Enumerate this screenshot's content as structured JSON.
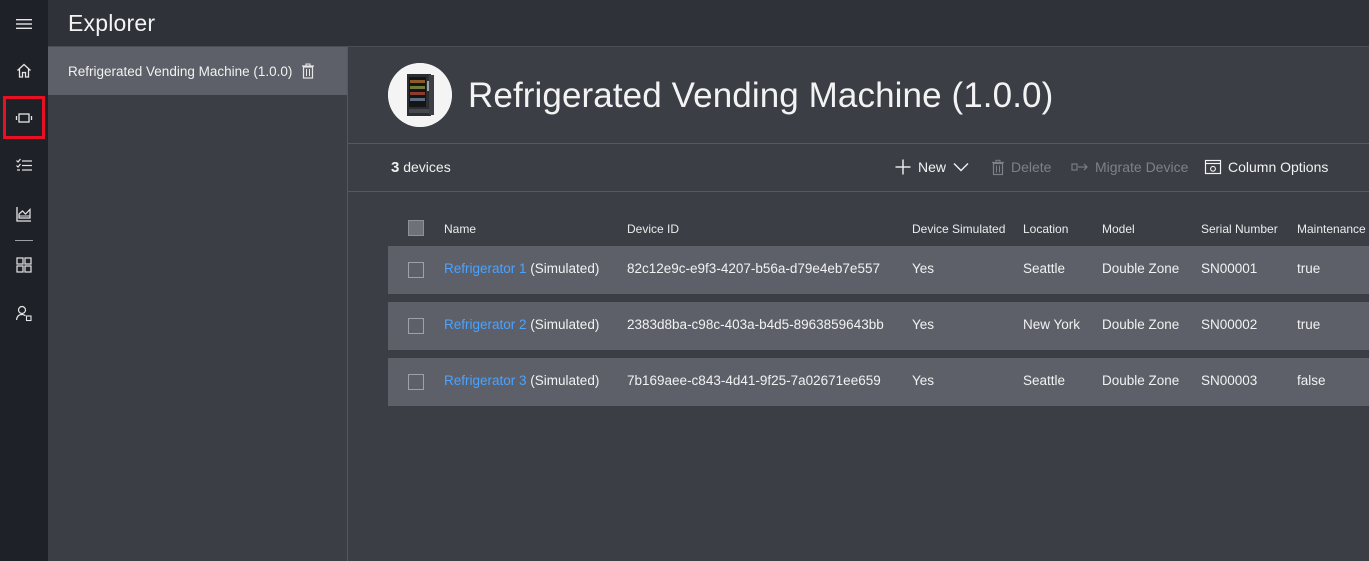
{
  "app": {
    "header_title": "Explorer"
  },
  "rail": {
    "items": [
      {
        "icon": "hamburger-menu-icon"
      },
      {
        "icon": "home-icon"
      },
      {
        "icon": "devices-icon",
        "active": true
      },
      {
        "icon": "rules-icon"
      },
      {
        "icon": "analytics-icon"
      },
      {
        "icon": "dashboard-icon"
      },
      {
        "icon": "administration-icon"
      }
    ],
    "highlight_color": "#e81123"
  },
  "templates": {
    "items": [
      {
        "label": "Refrigerated Vending Machine (1.0.0)",
        "selected": true
      }
    ]
  },
  "device_template": {
    "title": "Refrigerated Vending Machine (1.0.0)",
    "image_icon": "vending-machine-image"
  },
  "toolbar": {
    "count_number": "3",
    "count_label": "devices",
    "new_label": "New",
    "delete_label": "Delete",
    "migrate_label": "Migrate Device",
    "column_options_label": "Column Options"
  },
  "table": {
    "columns": [
      "Name",
      "Device ID",
      "Device Simulated",
      "Location",
      "Model",
      "Serial Number",
      "Maintenance"
    ],
    "rows": [
      {
        "name_link": "Refrigerator 1",
        "name_suffix": " (Simulated)",
        "device_id": "82c12e9c-e9f3-4207-b56a-d79e4eb7e557",
        "simulated": "Yes",
        "location": "Seattle",
        "model": "Double Zone",
        "serial": "SN00001",
        "maintenance": "true"
      },
      {
        "name_link": "Refrigerator 2",
        "name_suffix": " (Simulated)",
        "device_id": "2383d8ba-c98c-403a-b4d5-8963859643bb",
        "simulated": "Yes",
        "location": "New York",
        "model": "Double Zone",
        "serial": "SN00002",
        "maintenance": "true"
      },
      {
        "name_link": "Refrigerator 3",
        "name_suffix": " (Simulated)",
        "device_id": "7b169aee-c843-4d41-9f25-7a02671ee659",
        "simulated": "Yes",
        "location": "Seattle",
        "model": "Double Zone",
        "serial": "SN00003",
        "maintenance": "false"
      }
    ]
  },
  "colors": {
    "link": "#4aa3ff",
    "rail_bg": "#1e2128",
    "header_bg": "#2f3238",
    "content_bg": "#3b3e45",
    "row_bg": "#5d6068"
  }
}
